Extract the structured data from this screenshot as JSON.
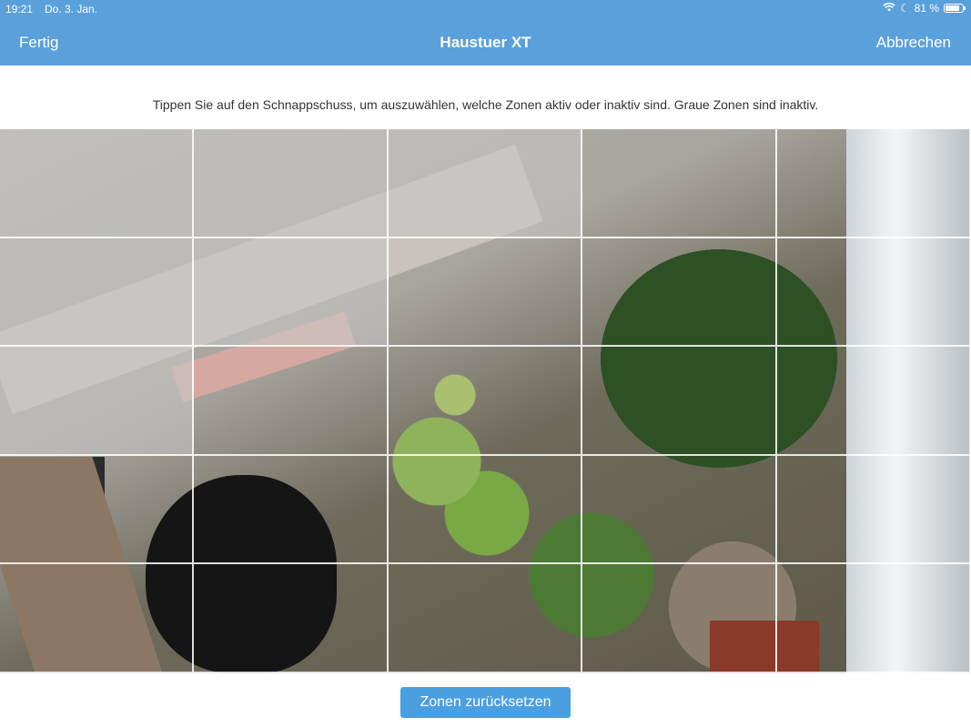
{
  "status_bar": {
    "time": "19:21",
    "date": "Do. 3. Jan.",
    "battery": "81 %",
    "battery_level": 0.81
  },
  "nav": {
    "left_label": "Fertig",
    "title": "Haustuer XT",
    "right_label": "Abbrechen"
  },
  "instruction": "Tippen Sie auf den Schnappschuss, um auszuwählen, welche Zonen aktiv oder inaktiv sind. Graue Zonen sind inaktiv.",
  "zones": {
    "rows": 5,
    "cols": 5,
    "inactive": [
      [
        true,
        true,
        true,
        false,
        false
      ],
      [
        true,
        true,
        false,
        false,
        false
      ],
      [
        true,
        false,
        false,
        false,
        false
      ],
      [
        false,
        false,
        false,
        false,
        false
      ],
      [
        false,
        false,
        false,
        false,
        false
      ]
    ]
  },
  "reset_button_label": "Zonen zurücksetzen",
  "colors": {
    "accent": "#5aa0db",
    "button": "#4a9fe0",
    "inactive_overlay": "rgba(200,200,200,0.55)"
  }
}
